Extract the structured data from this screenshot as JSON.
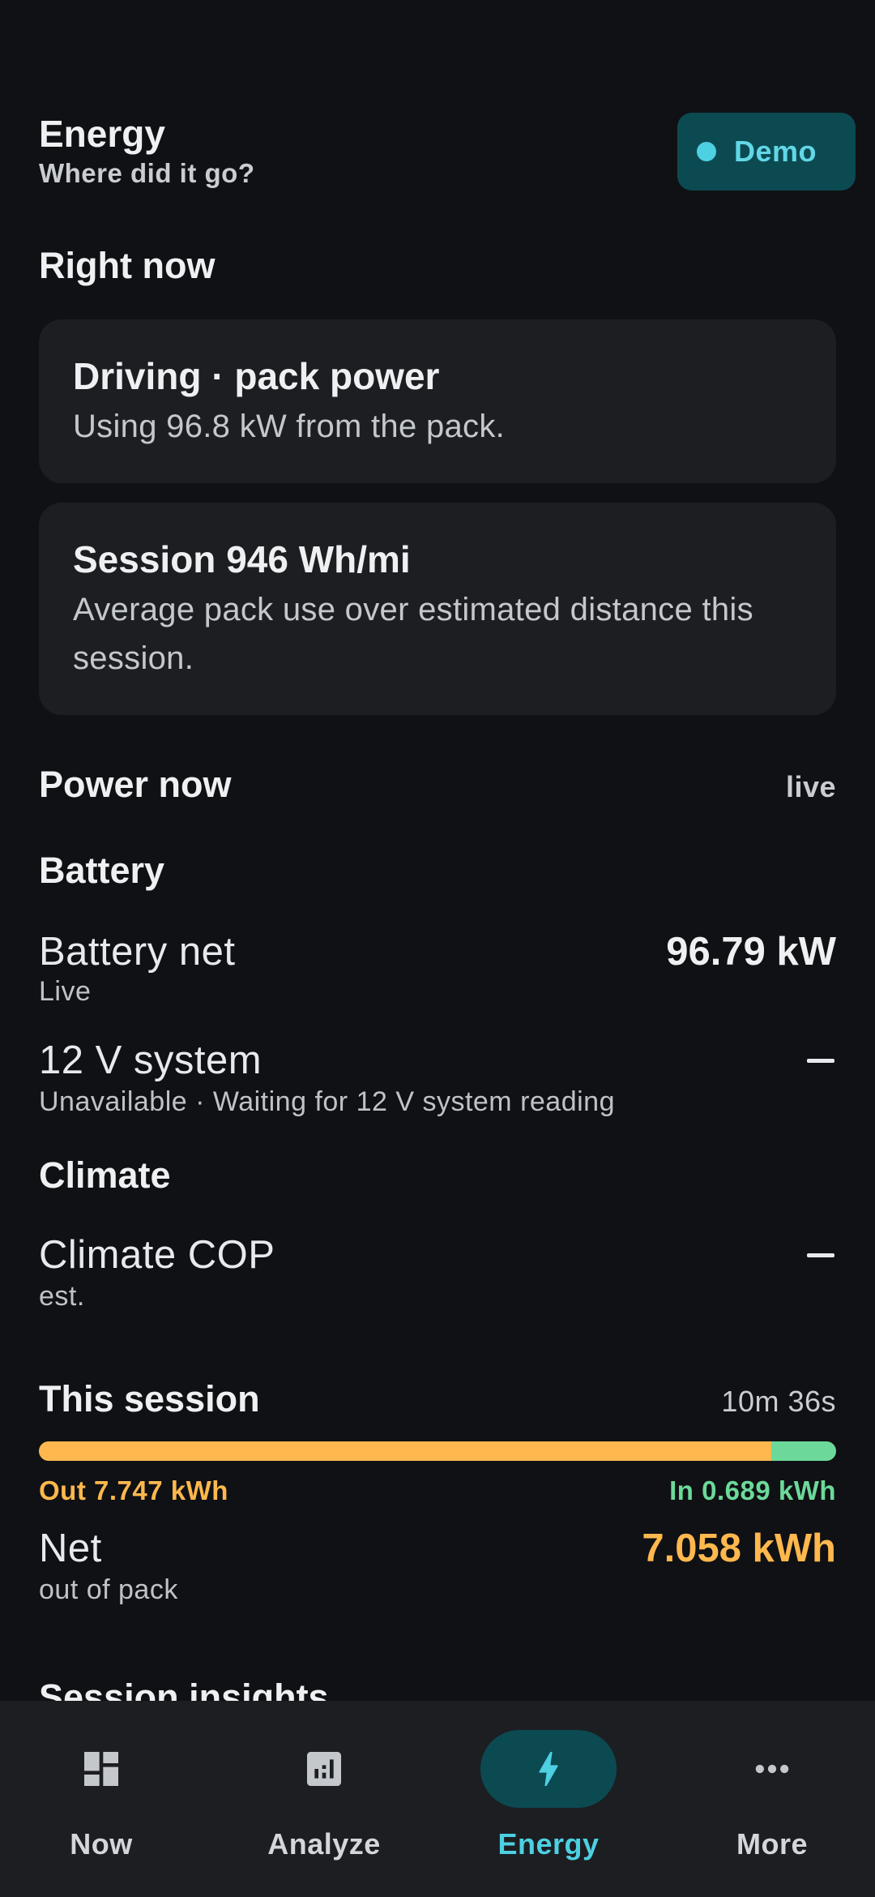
{
  "header": {
    "title": "Energy",
    "subtitle": "Where did it go?",
    "chip_label": "Demo"
  },
  "right_now": {
    "title": "Right now",
    "cards": [
      {
        "title": "Driving · pack power",
        "body": "Using 96.8 kW from the pack."
      },
      {
        "title": "Session 946 Wh/mi",
        "body": "Average pack use over estimated distance this session."
      }
    ]
  },
  "power_now": {
    "title": "Power now",
    "status": "live",
    "battery": {
      "title": "Battery",
      "net_label": "Battery net",
      "net_sub": "Live",
      "net_value": "96.79 kW",
      "sys12_label": "12 V system",
      "sys12_sub": "Unavailable · Waiting for 12 V system reading",
      "sys12_value": "—"
    },
    "climate": {
      "title": "Climate",
      "cop_label": "Climate COP",
      "cop_sub": "est.",
      "cop_value": "—"
    }
  },
  "session": {
    "title": "This session",
    "duration": "10m 36s",
    "out_kwh": 7.747,
    "in_kwh": 0.689,
    "out_label": "Out 7.747 kWh",
    "in_label": "In 0.689 kWh",
    "net_label": "Net",
    "net_sub": "out of pack",
    "net_value": "7.058 kWh"
  },
  "next_section_title": "Session insights",
  "colors": {
    "accent": "#4dd0e1",
    "out": "#ffb84d",
    "in": "#6cd99a",
    "chip_bg": "#0c4a52"
  },
  "nav": {
    "items": [
      {
        "label": "Now",
        "icon": "dashboard-icon"
      },
      {
        "label": "Analyze",
        "icon": "bar-chart-icon"
      },
      {
        "label": "Energy",
        "icon": "bolt-icon",
        "active": true
      },
      {
        "label": "More",
        "icon": "more-horiz-icon"
      }
    ]
  }
}
